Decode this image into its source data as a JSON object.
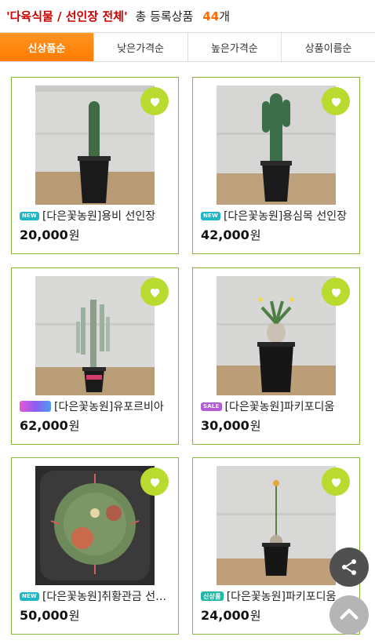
{
  "header": {
    "category": "'다육식물 / 선인장 전체'",
    "total_label": "총 등록상품",
    "count": "44",
    "unit": "개"
  },
  "tabs": [
    {
      "label": "신상품순",
      "active": true
    },
    {
      "label": "낮은가격순",
      "active": false
    },
    {
      "label": "높은가격순",
      "active": false
    },
    {
      "label": "상품이름순",
      "active": false
    }
  ],
  "products": [
    {
      "badge": "NEW",
      "badge_type": "new",
      "title": "[다은꽃농원]용비 선인장",
      "price": "20,000",
      "currency": "원"
    },
    {
      "badge": "NEW",
      "badge_type": "new",
      "title": "[다은꽃농원]용심목 선인장",
      "price": "42,000",
      "currency": "원"
    },
    {
      "badge": "",
      "badge_type": "grad",
      "title": "[다은꽃농원]유포르비아",
      "price": "62,000",
      "currency": "원"
    },
    {
      "badge": "SALE",
      "badge_type": "sale",
      "title": "[다은꽃농원]파키포디움",
      "price": "30,000",
      "currency": "원"
    },
    {
      "badge": "NEW",
      "badge_type": "new",
      "title": "[다은꽃농원]취황관금 선인장",
      "price": "50,000",
      "currency": "원"
    },
    {
      "badge": "신상품",
      "badge_type": "teal",
      "title": "[다은꽃농원]파키포디움",
      "price": "24,000",
      "currency": "원"
    }
  ],
  "colors": {
    "accent_orange": "#ff7b00",
    "card_border": "#8ab53b",
    "heart_green": "#b9db2f",
    "category_red": "#cc0000"
  },
  "icons": {
    "wishlist": "heart-icon",
    "share": "share-icon",
    "scroll_top": "chevron-up-icon"
  }
}
